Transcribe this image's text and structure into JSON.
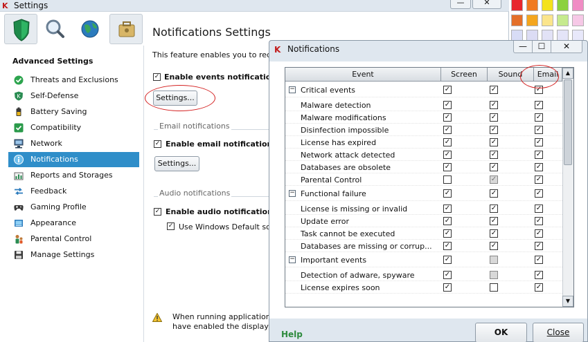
{
  "settings_window": {
    "title": "Settings",
    "minimize_label": "—",
    "close_label": "✕"
  },
  "toolbar": {
    "items": [
      {
        "name": "protection",
        "icon": "shield-icon",
        "color": "#1e8a4a"
      },
      {
        "name": "scan",
        "icon": "magnifier-icon",
        "color": "#3a6fa8"
      },
      {
        "name": "update",
        "icon": "globe-icon",
        "color": "#2b7bbd"
      },
      {
        "name": "tools",
        "icon": "briefcase-icon",
        "color": "#c9a556"
      }
    ]
  },
  "sidebar": {
    "heading": "Advanced Settings",
    "items": [
      {
        "label": "Threats and Exclusions",
        "icon": "check-circle-icon",
        "active": false
      },
      {
        "label": "Self-Defense",
        "icon": "shield-k-icon",
        "active": false
      },
      {
        "label": "Battery Saving",
        "icon": "battery-icon",
        "active": false
      },
      {
        "label": "Compatibility",
        "icon": "check-square-icon",
        "active": false
      },
      {
        "label": "Network",
        "icon": "network-icon",
        "active": false
      },
      {
        "label": "Notifications",
        "icon": "info-icon",
        "active": true
      },
      {
        "label": "Reports and Storages",
        "icon": "reports-icon",
        "active": false
      },
      {
        "label": "Feedback",
        "icon": "arrows-icon",
        "active": false
      },
      {
        "label": "Gaming Profile",
        "icon": "gamepad-icon",
        "active": false
      },
      {
        "label": "Appearance",
        "icon": "palette-icon",
        "active": false
      },
      {
        "label": "Parental Control",
        "icon": "parental-icon",
        "active": false
      },
      {
        "label": "Manage Settings",
        "icon": "floppy-icon",
        "active": false
      }
    ]
  },
  "content": {
    "title": "Notifications Settings",
    "feature_text": "This feature enables you to receive",
    "events_checkbox_label": "Enable events notifications",
    "events_checked": true,
    "settings_button_label": "Settings...",
    "email_section_label": "Email notifications",
    "email_checkbox_label": "Enable email notifications",
    "email_checked": true,
    "email_settings_button_label": "Settings...",
    "audio_section_label": "Audio notifications",
    "audio_checkbox_label": "Enable audio notifications",
    "audio_checked": true,
    "windows_sound_label": "Use Windows Default sound",
    "windows_sound_checked": true,
    "warning_line1": "When running applications",
    "warning_line2": "have enabled the display by"
  },
  "swatches": {
    "rows": [
      [
        "#e8262e",
        "#f07a22",
        "#f4e21c",
        "#8cd13e",
        "#f08cc4"
      ],
      [
        "#e4702a",
        "#f4a61e",
        "#fbe58c",
        "#c6ea8e",
        "#f6c8e6"
      ],
      [
        "#d8dcf6",
        "#dcdcf4",
        "#e2e2f6",
        "#e4e4f8",
        "#e8e8fa"
      ]
    ]
  },
  "notifications_dialog": {
    "title": "Notifications",
    "minimize_label": "—",
    "maximize_label": "☐",
    "close_label": "✕",
    "columns": [
      "Event",
      "Screen",
      "Sound",
      "Email"
    ],
    "groups": [
      {
        "label": "Critical events",
        "expander": "−",
        "screen": "checked",
        "sound": "checked",
        "email": "checked",
        "rows": [
          {
            "label": "Malware detection",
            "screen": "checked",
            "sound": "checked",
            "email": "checked"
          },
          {
            "label": "Malware modifications",
            "screen": "checked",
            "sound": "checked",
            "email": "checked"
          },
          {
            "label": "Disinfection impossible",
            "screen": "checked",
            "sound": "checked",
            "email": "checked"
          },
          {
            "label": "License has expired",
            "screen": "checked",
            "sound": "checked",
            "email": "checked"
          },
          {
            "label": "Network attack detected",
            "screen": "checked",
            "sound": "checked",
            "email": "checked"
          },
          {
            "label": "Databases are obsolete",
            "screen": "checked",
            "sound": "checked",
            "email": "checked"
          },
          {
            "label": "Parental Control",
            "screen": "unchecked",
            "sound": "disabled-checked",
            "email": "checked"
          }
        ]
      },
      {
        "label": "Functional failure",
        "expander": "−",
        "screen": "checked",
        "sound": "checked",
        "email": "checked",
        "rows": [
          {
            "label": "License is missing or invalid",
            "screen": "checked",
            "sound": "checked",
            "email": "checked"
          },
          {
            "label": "Update error",
            "screen": "checked",
            "sound": "checked",
            "email": "checked"
          },
          {
            "label": "Task cannot be executed",
            "screen": "checked",
            "sound": "checked",
            "email": "checked"
          },
          {
            "label": "Databases are missing or corrup...",
            "screen": "checked",
            "sound": "checked",
            "email": "checked"
          }
        ]
      },
      {
        "label": "Important events",
        "expander": "−",
        "screen": "checked",
        "sound": "disabled",
        "email": "checked",
        "rows": [
          {
            "label": "Detection of adware, spyware",
            "screen": "checked",
            "sound": "disabled",
            "email": "checked"
          },
          {
            "label": "License expires soon",
            "screen": "checked",
            "sound": "unchecked",
            "email": "checked"
          }
        ]
      }
    ],
    "help_label": "Help",
    "ok_label": "OK",
    "close_button_label": "Close",
    "scroll_up_glyph": "▲",
    "scroll_down_glyph": "▼"
  },
  "colors": {
    "accent_active": "#2f8ec9",
    "help_green": "#2e8b3e",
    "annotation_red": "#d42020"
  }
}
